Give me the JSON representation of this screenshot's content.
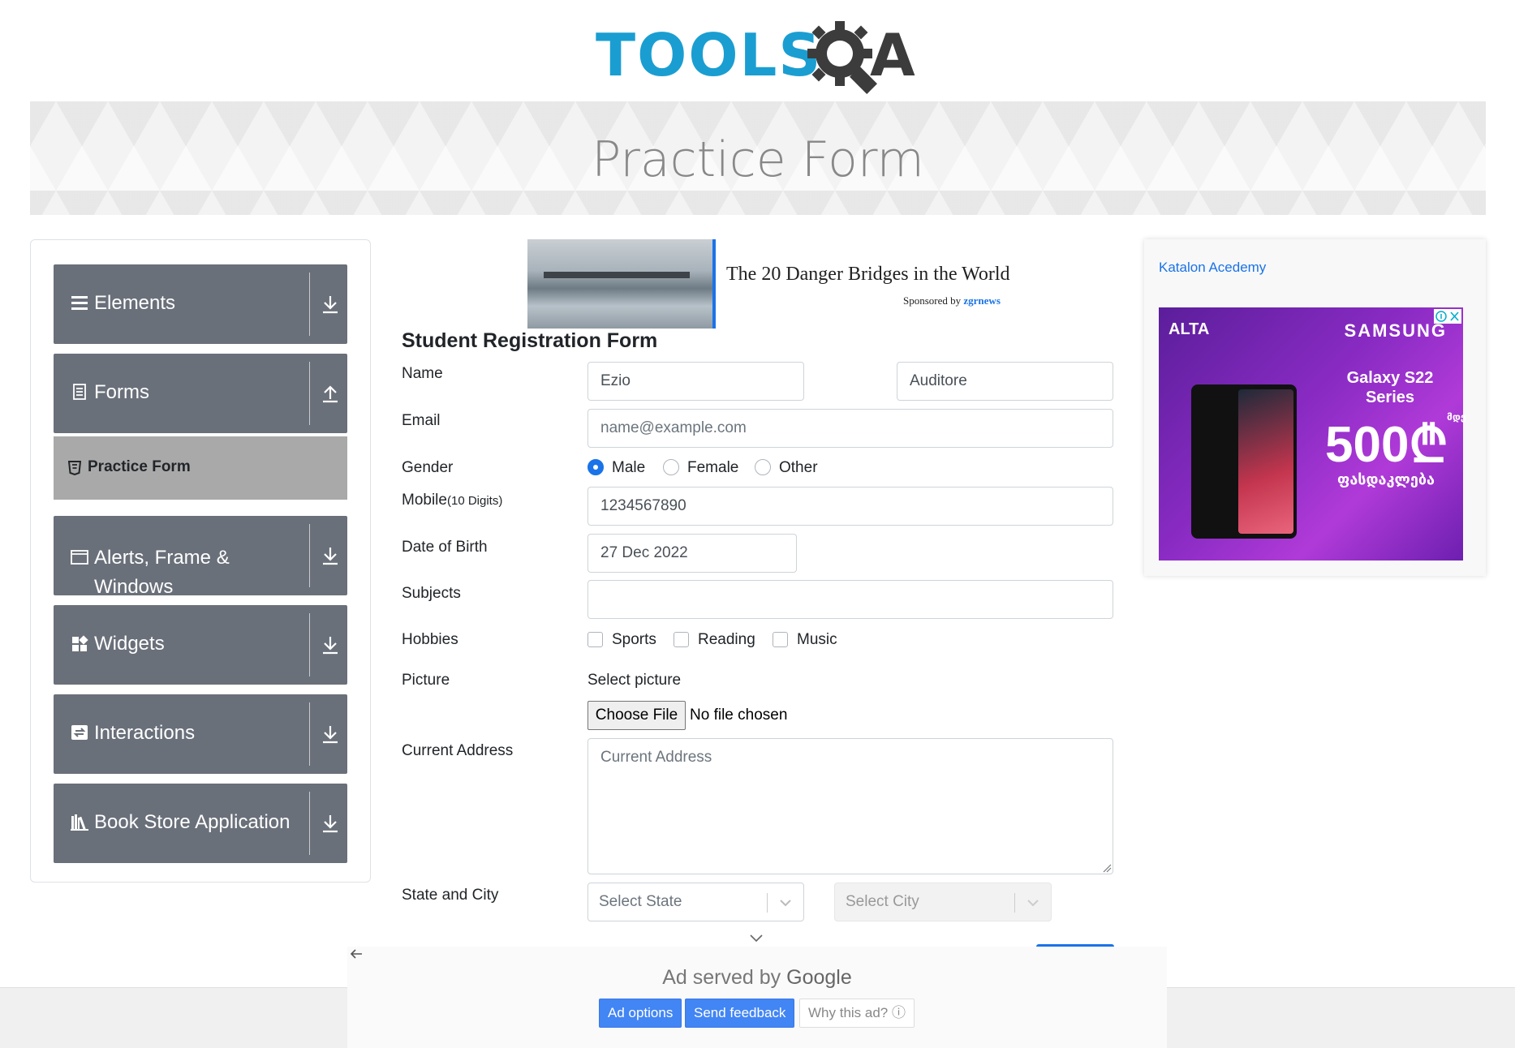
{
  "logo": {
    "text": "TOOLS",
    "suffix": "A",
    "q_icon": "gear-magnifier-icon"
  },
  "banner": {
    "title": "Practice Form"
  },
  "sidebar": {
    "groups": [
      {
        "label": "Elements",
        "icon": "hamburger-icon",
        "arrow": "download-arrow-icon"
      },
      {
        "label": "Forms",
        "icon": "document-icon",
        "arrow": "upload-arrow-icon"
      },
      {
        "label": "Alerts, Frame &",
        "label2": "Windows",
        "icon": "window-icon",
        "arrow": "download-arrow-icon"
      },
      {
        "label": "Widgets",
        "icon": "widgets-icon",
        "arrow": "download-arrow-icon"
      },
      {
        "label": "Interactions",
        "icon": "interactions-icon",
        "arrow": "download-arrow-icon"
      },
      {
        "label": "Book Store Application",
        "icon": "books-icon",
        "arrow": "download-arrow-icon"
      }
    ],
    "active_item": {
      "label": "Practice Form",
      "icon": "html5-icon"
    }
  },
  "ad_top": {
    "title": "The 20 Danger Bridges in the World",
    "sponsored_prefix": "Sponsored by",
    "sponsor": "zgrnews"
  },
  "form": {
    "title": "Student Registration Form",
    "name_label": "Name",
    "first_name": "Ezio",
    "last_name": "Auditore",
    "email_label": "Email",
    "email_placeholder": "name@example.com",
    "gender_label": "Gender",
    "gender_options": [
      "Male",
      "Female",
      "Other"
    ],
    "gender_selected": "Male",
    "mobile_label": "Mobile",
    "mobile_hint": "(10 Digits)",
    "mobile_value": "1234567890",
    "dob_label": "Date of Birth",
    "dob_value": "27 Dec 2022",
    "subjects_label": "Subjects",
    "subjects_value": "",
    "hobbies_label": "Hobbies",
    "hobbies": [
      "Sports",
      "Reading",
      "Music"
    ],
    "picture_label": "Picture",
    "picture_hint": "Select picture",
    "choose_file": "Choose File",
    "no_file": "No file chosen",
    "address_label": "Current Address",
    "address_placeholder": "Current Address",
    "state_city_label": "State and City",
    "state_placeholder": "Select State",
    "city_placeholder": "Select City"
  },
  "ad_right": {
    "alt_link": "Katalon Acedemy",
    "brand_left": "ALTA",
    "brand_right": "SAMSUNG",
    "product": "Galaxy S22 Series",
    "price": "500₾",
    "price_unit": "მდე",
    "discount_text": "ფასდაკლება"
  },
  "google_ad": {
    "served_by": "Ad served by",
    "google": "Google",
    "ad_options": "Ad options",
    "send_feedback": "Send feedback",
    "why_this_ad": "Why this ad? ⓘ"
  },
  "colors": {
    "brand_blue": "#1a9ed1",
    "sidebar_group": "#6a707a",
    "active_item": "#a9a9a9",
    "primary": "#1a73e8",
    "google_blue": "#4285f4"
  }
}
